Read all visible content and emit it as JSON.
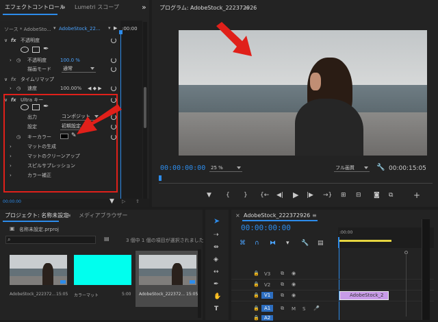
{
  "effect_controls": {
    "tab_active": "エフェクトコントロール",
    "tab_menu": "≡",
    "tab_lumetri": "Lumetri スコープ",
    "overflow": "»",
    "source_label": "ソース * AdobeSto...",
    "clip_selector": "AdobeStock_22...",
    "timecode": ":00:00",
    "opacity_name": "不透明度",
    "opacity_label": "不透明度",
    "opacity_value": "100.0 %",
    "blend_label": "描画モード",
    "blend_value": "通常",
    "timeremap_name": "タイムリマップ",
    "speed_label": "速度",
    "speed_value": "100.00%",
    "ultra_name": "Ultra キー",
    "output_label": "出力",
    "output_value": "コンポジット",
    "setting_label": "設定",
    "setting_value": "初期設定",
    "keycolor_label": "キーカラー",
    "sub1": "マットの生成",
    "sub2": "マットのクリーンアップ",
    "sub3": "スピルサプレッション",
    "sub4": "カラー補正",
    "bottom_tc": "00:00:00",
    "fx": "fx"
  },
  "program": {
    "title": "プログラム: AdobeStock_222372926",
    "menu": "≡",
    "timecode": "00:00:00:00",
    "zoom": "25 %",
    "quality": "フル画質",
    "duration": "00:00:15:05",
    "btn_marker": "▼",
    "btn_in": "{",
    "btn_out": "}",
    "btn_goto_in": "{←",
    "btn_step_back": "◀|",
    "btn_play": "▶",
    "btn_step_fwd": "|▶",
    "btn_goto_out": "→}",
    "btn_add": "+"
  },
  "project": {
    "tab_active": "プロジェクト: 名称未設定",
    "tab_menu": "≡",
    "tab_media": "メディアブラウザー",
    "file_name": "名称未設定.prproj",
    "status": "3 個中 1 個の項目が選択されました",
    "items": [
      {
        "name": "AdobeStock_222372...",
        "duration": "15:05"
      },
      {
        "name": "カラーマット",
        "duration": "5:00"
      },
      {
        "name": "AdobeStock_222372...",
        "duration": "15:05"
      }
    ]
  },
  "timeline": {
    "close": "×",
    "title": "AdobeStock_222372926",
    "menu": "≡",
    "timecode": "00:00:00:00",
    "ruler_start": ":00:00",
    "tracks": [
      "V3",
      "V2",
      "V1",
      "A1",
      "A2"
    ],
    "clip_label": "AdobeStock_2",
    "mute": "M",
    "solo": "S"
  },
  "colors": {
    "accent": "#2d8ceb",
    "highlight": "#e0201a",
    "clip": "#c89be8",
    "matte": "#00ffee"
  },
  "icons": [
    "ellipse-mask-icon",
    "rect-mask-icon",
    "pen-icon",
    "eyedropper-icon",
    "wrench-icon",
    "camera-icon",
    "selection-tool-icon",
    "razor-tool-icon",
    "hand-tool-icon",
    "type-tool-icon"
  ]
}
